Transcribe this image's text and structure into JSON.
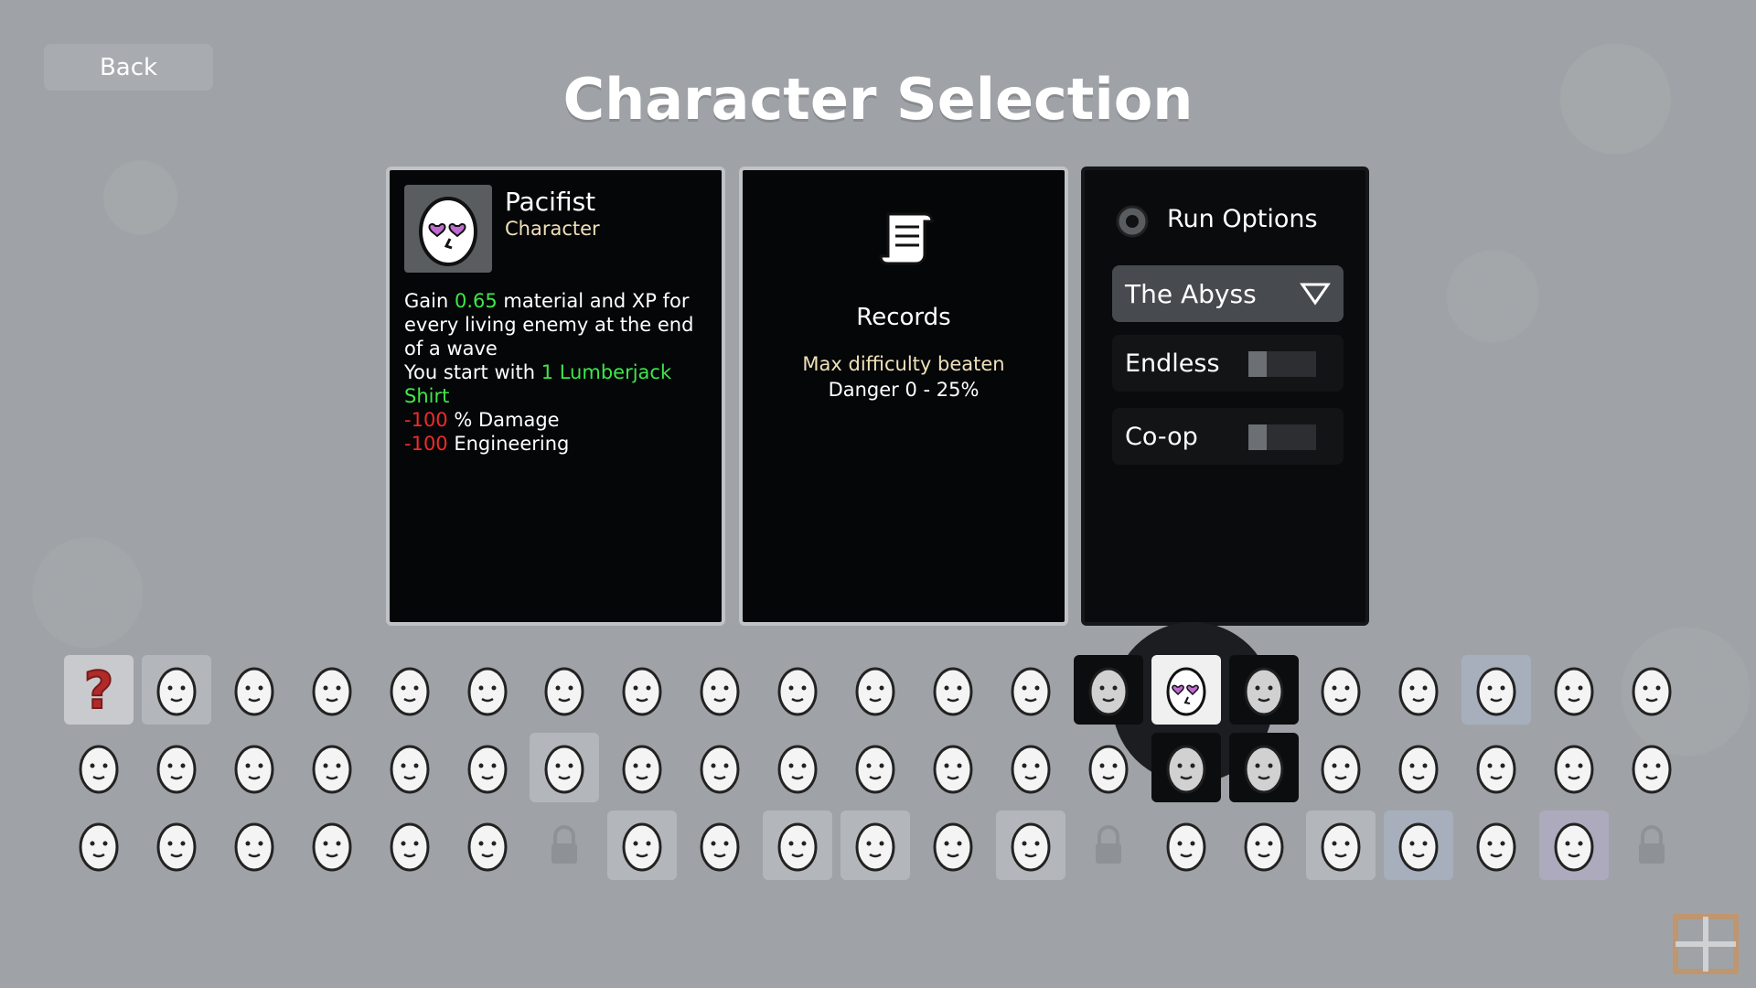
{
  "header": {
    "back_label": "Back",
    "title": "Character Selection"
  },
  "character": {
    "name": "Pacifist",
    "type": "Character",
    "desc": {
      "gain_prefix": "Gain ",
      "gain_value": "0.65",
      "gain_suffix": " material and XP for every living enemy at the end of a wave",
      "start_prefix": "You start with ",
      "start_item": "1 Lumberjack Shirt",
      "stat1_value": "-100",
      "stat1_label": " % Damage",
      "stat2_value": "-100",
      "stat2_label": " Engineering"
    },
    "icon": "pacifist-egg-heart-eyes"
  },
  "records": {
    "title": "Records",
    "line1": "Max difficulty beaten",
    "line2": "Danger 0 - 25%",
    "icon": "scroll-icon"
  },
  "run_options": {
    "title": "Run Options",
    "icon": "gear-icon",
    "dropdown_value": "The Abyss",
    "endless_label": "Endless",
    "endless_on": false,
    "coop_label": "Co-op",
    "coop_on": false
  },
  "grid": {
    "columns": 21,
    "rows": [
      [
        "random",
        "lit",
        "plain",
        "plain",
        "plain",
        "plain",
        "plain",
        "plain",
        "plain",
        "plain",
        "plain",
        "plain",
        "plain",
        "dark",
        "selected",
        "dark",
        "plain",
        "plain",
        "blue",
        "plain",
        "plain"
      ],
      [
        "plain",
        "plain",
        "plain",
        "plain",
        "plain",
        "plain",
        "lit",
        "plain",
        "plain",
        "plain",
        "plain",
        "plain",
        "plain",
        "plain",
        "dark",
        "dark",
        "plain",
        "plain",
        "plain",
        "plain",
        "plain"
      ],
      [
        "plain",
        "plain",
        "plain",
        "plain",
        "plain",
        "plain",
        "locked",
        "lit",
        "plain",
        "lit",
        "lit",
        "plain",
        "lit",
        "locked",
        "plain",
        "plain",
        "lit",
        "blue",
        "plain",
        "purple",
        "locked"
      ]
    ]
  },
  "colors": {
    "background": "#9fa3a7",
    "panel": "#050608",
    "green_value": "#3ee64a",
    "red_value": "#ef2a2a",
    "subtitle": "#efe0b9"
  }
}
